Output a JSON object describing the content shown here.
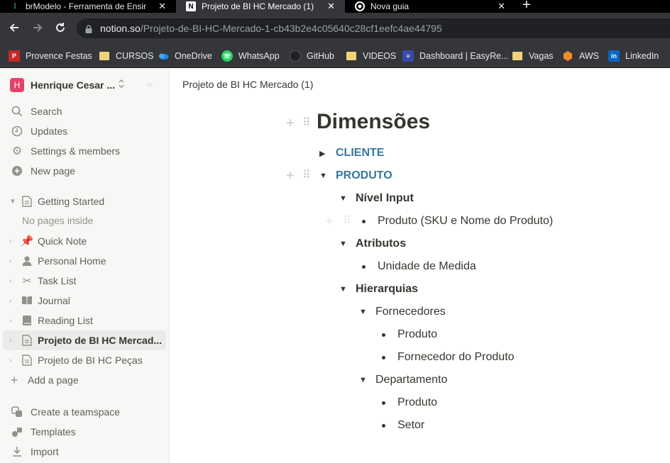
{
  "browser": {
    "tabs": [
      {
        "title": "brModelo - Ferramenta de Ensino",
        "active": false
      },
      {
        "title": "Projeto de BI HC Mercado (1)",
        "active": true
      },
      {
        "title": "Nova guia",
        "active": false
      }
    ],
    "close_glyph": "✕",
    "new_tab_glyph": "+",
    "url_host": "notion.so",
    "url_path": "/Projeto-de-BI-HC-Mercado-1-cb43b2e4c05640c28cf1eefc4ae44795",
    "bookmarks": [
      {
        "label": "Provence Festas",
        "icon": "provence-icon"
      },
      {
        "label": "CURSOS",
        "icon": "folder-icon"
      },
      {
        "label": "OneDrive",
        "icon": "onedrive-icon"
      },
      {
        "label": "WhatsApp",
        "icon": "whatsapp-icon"
      },
      {
        "label": "GitHub",
        "icon": "github-icon"
      },
      {
        "label": "VIDEOS",
        "icon": "folder-icon"
      },
      {
        "label": "Dashboard | EasyRe...",
        "icon": "easyre-icon"
      },
      {
        "label": "Vagas",
        "icon": "folder-icon"
      },
      {
        "label": "AWS",
        "icon": "aws-icon"
      },
      {
        "label": "LinkedIn",
        "icon": "linkedin-icon"
      }
    ]
  },
  "sidebar": {
    "workspace_initial": "H",
    "workspace_name": "Henrique Cesar ...",
    "top_items": [
      {
        "label": "Search",
        "icon": "search-icon"
      },
      {
        "label": "Updates",
        "icon": "clock-icon"
      },
      {
        "label": "Settings & members",
        "icon": "gear-icon"
      },
      {
        "label": "New page",
        "icon": "plus-circle-icon"
      }
    ],
    "pages": [
      {
        "label": "Getting Started",
        "icon": "page-icon",
        "expanded": true
      },
      {
        "label": "Quick Note",
        "icon": "pin-icon"
      },
      {
        "label": "Personal Home",
        "icon": "person-icon"
      },
      {
        "label": "Task List",
        "icon": "scissors-icon"
      },
      {
        "label": "Journal",
        "icon": "book-icon"
      },
      {
        "label": "Reading List",
        "icon": "books-icon"
      },
      {
        "label": "Projeto de BI HC Mercad...",
        "icon": "page-icon",
        "selected": true
      },
      {
        "label": "Projeto de BI HC Peças",
        "icon": "page-icon"
      }
    ],
    "no_pages_inside": "No pages inside",
    "add_page": "Add a page",
    "bottom_items": [
      {
        "label": "Create a teamspace",
        "icon": "teamspace-icon"
      },
      {
        "label": "Templates",
        "icon": "templates-icon"
      },
      {
        "label": "Import",
        "icon": "import-icon"
      }
    ]
  },
  "main": {
    "breadcrumb": "Projeto de BI HC Mercado (1)",
    "heading": "Dimensões",
    "toggle_cliente": "CLIENTE",
    "toggle_produto": "PRODUTO",
    "nivel_input": "Nível Input",
    "nivel_input_item": "Produto (SKU e Nome do Produto)",
    "atributos": "Atributos",
    "atributos_item": "Unidade de Medida",
    "hierarquias": "Hierarquias",
    "fornecedores": "Fornecedores",
    "fornecedores_items": [
      "Produto",
      "Fornecedor do Produto"
    ],
    "departamento": "Departamento",
    "departamento_items": [
      "Produto",
      "Setor"
    ]
  },
  "colors": {
    "toggle_heading": "#36789b",
    "workspace_avatar": "#e3436b",
    "sidebar_bg": "#f7f7f5"
  }
}
